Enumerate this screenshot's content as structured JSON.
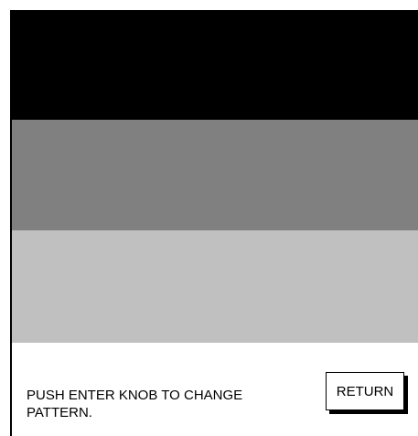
{
  "pattern": {
    "bands": [
      {
        "color": "#000000"
      },
      {
        "color": "#808080"
      },
      {
        "color": "#c0c0c0"
      }
    ]
  },
  "footer": {
    "message": "PUSH ENTER KNOB TO CHANGE\nPATTERN.",
    "return_label": "RETURN"
  }
}
